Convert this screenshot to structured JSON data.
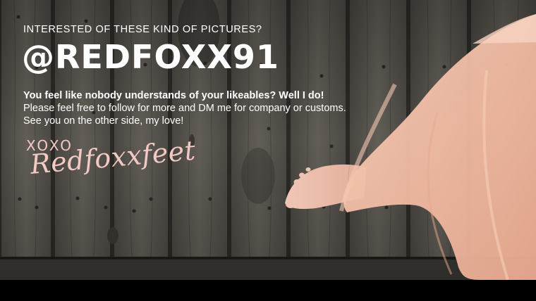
{
  "overlay": {
    "kicker": "INTERESTED OF THESE KIND OF PICTURES?",
    "handle": "@REDFOXX91",
    "message_bold": "You feel like nobody understands of your likeables? Well I do!",
    "message_line2": "Please feel free to follow for more and DM me for company or customs.",
    "message_line3": "See you on the other side, my love!",
    "xoxo": "XOXO",
    "signature": "Redfoxxfeet"
  },
  "colors": {
    "text_main": "#ffffff",
    "signature_pink": "#f3c9c4",
    "wood_dark": "#3c3a36",
    "wood_mid": "#5e5a54",
    "dress_peach": "#f2c0a8"
  }
}
